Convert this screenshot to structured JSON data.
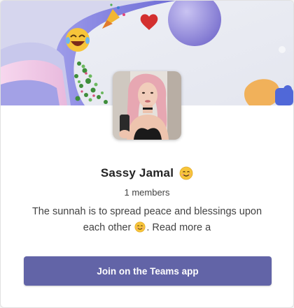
{
  "community": {
    "name": "Sassy Jamal",
    "name_emoji": "smiling-face-emoji",
    "members_text": "1 members",
    "description_part1": "The sunnah is to spread peace and blessings upon each other",
    "description_emoji": "smiling-face-emoji",
    "description_part2": ". Read more a"
  },
  "actions": {
    "join_label": "Join on the Teams app"
  },
  "colors": {
    "accent": "#6264a7",
    "title": "#242424",
    "body_text": "#424242",
    "card_bg": "#ffffff"
  },
  "banner": {
    "decorations": [
      "laughing-emoji",
      "party-popper-icon",
      "heart-icon",
      "sphere-decoration",
      "confetti-leaves",
      "pin-decoration"
    ]
  }
}
